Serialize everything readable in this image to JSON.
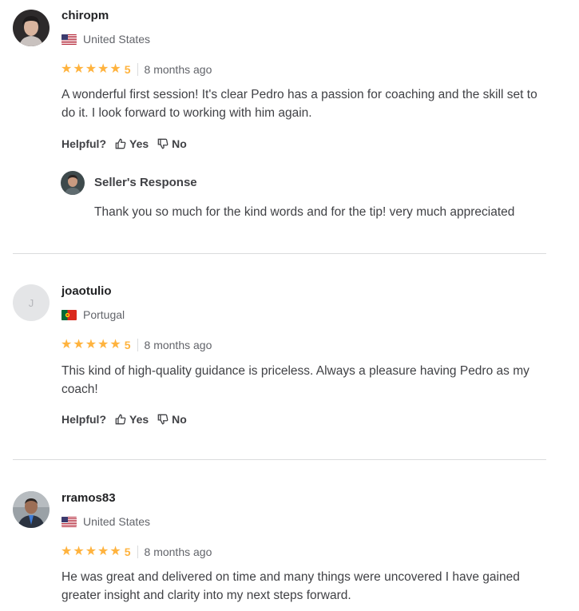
{
  "reviews": [
    {
      "username": "chiropm",
      "country": "United States",
      "flag": "us",
      "rating": "5",
      "age": "8 months ago",
      "text": "A wonderful first session! It's clear Pedro has a passion for coaching and the skill set to do it. I look forward to working with him again.",
      "helpful_label": "Helpful?",
      "yes_label": "Yes",
      "no_label": "No",
      "seller_response": {
        "title": "Seller's Response",
        "text": "Thank you so much for the kind words and for the tip! very much appreciated"
      }
    },
    {
      "username": "joaotulio",
      "avatar_letter": "J",
      "country": "Portugal",
      "flag": "pt",
      "rating": "5",
      "age": "8 months ago",
      "text": "This kind of high-quality guidance is priceless. Always a pleasure having Pedro as my coach!",
      "helpful_label": "Helpful?",
      "yes_label": "Yes",
      "no_label": "No"
    },
    {
      "username": "rramos83",
      "country": "United States",
      "flag": "us",
      "rating": "5",
      "age": "8 months ago",
      "text": "He was great and delivered on time and many things were uncovered I have gained greater insight and clarity into my next steps forward."
    }
  ],
  "colors": {
    "star": "#ffb33e",
    "text": "#404145",
    "muted": "#62646a",
    "divider": "#dadbdd"
  },
  "icons": {
    "star": "star-icon",
    "thumbs_up": "thumbs-up-icon",
    "thumbs_down": "thumbs-down-icon"
  }
}
